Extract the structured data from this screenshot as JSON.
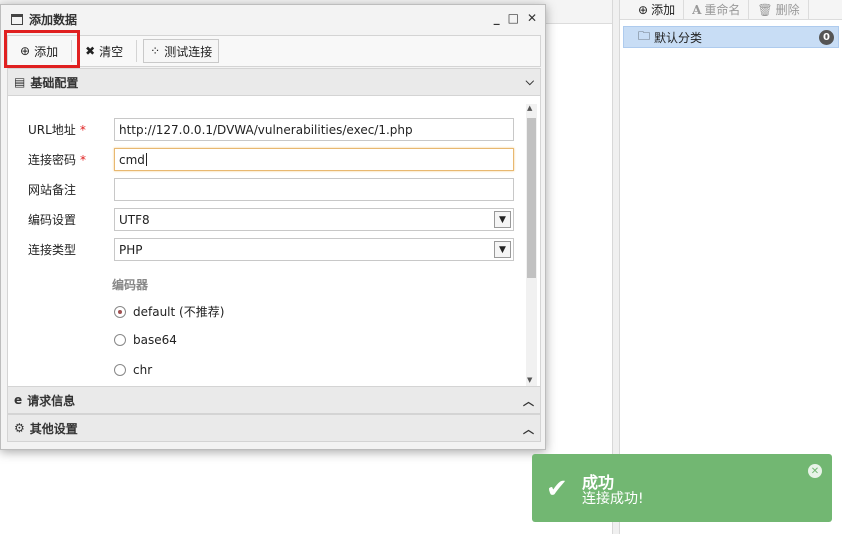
{
  "right_panel": {
    "toolbar": {
      "add_label": "添加",
      "rename_label": "重命名",
      "delete_label": "删除"
    },
    "tree": {
      "items": [
        {
          "label": "默认分类",
          "count": "0"
        }
      ]
    }
  },
  "dialog": {
    "title": "添加数据",
    "toolbar": {
      "add_label": "添加",
      "clear_label": "清空",
      "test_label": "测试连接"
    },
    "sections": {
      "basic": "基础配置",
      "request": "请求信息",
      "other": "其他设置"
    },
    "form": {
      "url_label": "URL地址",
      "url_value": "http://127.0.0.1/DVWA/vulnerabilities/exec/1.php",
      "password_label": "连接密码",
      "password_value": "cmd",
      "note_label": "网站备注",
      "note_value": "",
      "encoding_label": "编码设置",
      "encoding_value": "UTF8",
      "type_label": "连接类型",
      "type_value": "PHP",
      "encoder_label": "编码器",
      "encoders": [
        {
          "label": "default (不推荐)",
          "selected": true
        },
        {
          "label": "base64",
          "selected": false
        },
        {
          "label": "chr",
          "selected": false
        }
      ],
      "required_mark": "*"
    }
  },
  "toast": {
    "title": "成功",
    "message": "连接成功!"
  },
  "colors": {
    "toast_bg": "#72b772",
    "highlight": "#e02020",
    "tree_selected": "#c8ddf5"
  }
}
